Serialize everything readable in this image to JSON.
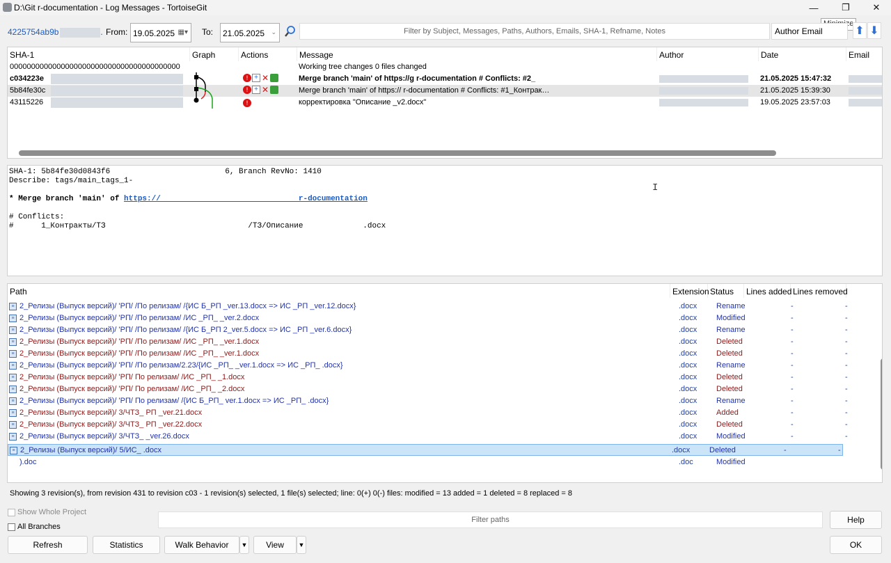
{
  "window": {
    "title": "D:\\Git        r-documentation - Log Messages - TortoiseGit",
    "minimize_glyph": "—",
    "restore_glyph": "❐",
    "close_glyph": "✕",
    "tooltip": "Minimize"
  },
  "toolbar": {
    "sha": "4225754ab9b",
    "from_label": "From:",
    "from_date": "19.05.2025",
    "to_label": "To:",
    "to_date": "21.05.2025",
    "filter_placeholder": "Filter by Subject, Messages, Paths, Authors, Emails, SHA-1, Refname, Notes",
    "author_filter": "Author Email",
    "up_glyph": "⬆",
    "down_glyph": "⬇"
  },
  "log": {
    "columns": [
      "SHA-1",
      "Graph",
      "Actions",
      "Message",
      "Author",
      "Date",
      "Email"
    ],
    "rows": [
      {
        "sha": "0000000000000000000000000000000000000000",
        "message": "Working tree changes  0 files changed",
        "date": ""
      },
      {
        "sha": "c034223e",
        "message": "Merge branch 'main' of https://g                              r-documentation  # Conflicts: #2_",
        "date": "21.05.2025 15:47:32"
      },
      {
        "sha": "5b84fe30c",
        "message": "Merge branch 'main' of https://                              r-documentation  # Conflicts: #1_Контрак…",
        "date": "21.05.2025 15:39:30"
      },
      {
        "sha": "43115226",
        "message": "корректировка \"Описание                                _v2.docx\"",
        "date": "19.05.2025 23:57:03"
      }
    ]
  },
  "detail": {
    "line1": "SHA-1: 5b84fe30d0843f6                         6, Branch RevNo: 1410",
    "line2": "Describe: tags/main_tags_1-",
    "merge_prefix": "* Merge branch 'main' of ",
    "merge_url": "https://                              r-documentation",
    "conflicts": "# Conflicts:",
    "conflict_line": "#      1_Контракты/ТЗ                               /ТЗ/Описание             .docx"
  },
  "files": {
    "columns": [
      "Path",
      "Extension",
      "Status",
      "Lines added",
      "Lines removed"
    ],
    "rows": [
      {
        "path": "2_Релизы (Выпуск версий)/        'РП/         /По релизам/    /{ИС         Б_РП           _ver.13.docx => ИС        _РП              _ver.12.docx}",
        "ext": ".docx",
        "status": "Rename",
        "added": "-",
        "removed": "-"
      },
      {
        "path": "2_Релизы (Выпуск версий)/        'РП/         /По релизам/    /ИС          _РП_           _ver.2.docx",
        "ext": ".docx",
        "status": "Modified",
        "added": "-",
        "removed": "-"
      },
      {
        "path": "2_Релизы (Выпуск версий)/        'РП/         /По релизам/    /{ИС         Б_РП           2_ver.5.docx => ИС        _РП              _ver.6.docx}",
        "ext": ".docx",
        "status": "Rename",
        "added": "-",
        "removed": "-"
      },
      {
        "path": "2_Релизы (Выпуск версий)/        'РП/         /По релизам/    /ИС          _РП_           _ver.1.docx",
        "ext": ".docx",
        "status": "Deleted",
        "added": "-",
        "removed": "-"
      },
      {
        "path": "2_Релизы (Выпуск версий)/        'РП/         /По релизам/    /ИС          _РП_           _ver.1.docx",
        "ext": ".docx",
        "status": "Deleted",
        "added": "-",
        "removed": "-"
      },
      {
        "path": "2_Релизы (Выпуск версий)/        'РП/          /По релизам/2.23/{ИС            _РП_       _ver.1.docx => ИС         _РП_       .docx}",
        "ext": ".docx",
        "status": "Rename",
        "added": "-",
        "removed": "-"
      },
      {
        "path": "2_Релизы (Выпуск версий)/        'РП/     По релизам/    /ИС         _РП_          _1.docx",
        "ext": ".docx",
        "status": "Deleted",
        "added": "-",
        "removed": "-"
      },
      {
        "path": "2_Релизы (Выпуск версий)/        'РП/     По релизам/    /ИС         _РП_          _2.docx",
        "ext": ".docx",
        "status": "Deleted",
        "added": "-",
        "removed": "-"
      },
      {
        "path": "2_Релизы (Выпуск версий)/        'РП/          По релизам/    /{ИС        Б_РП_        ver.1.docx => ИС         _РП_       .docx}",
        "ext": ".docx",
        "status": "Rename",
        "added": "-",
        "removed": "-"
      },
      {
        "path": "2_Релизы (Выпуск версий)/        3/ЧТЗ_      РП                                _ver.21.docx",
        "ext": ".docx",
        "status": "Added",
        "added": "-",
        "removed": "-"
      },
      {
        "path": "2_Релизы (Выпуск версий)/        3/ЧТЗ_      РП                                _ver.22.docx",
        "ext": ".docx",
        "status": "Deleted",
        "added": "-",
        "removed": "-"
      },
      {
        "path": "2_Релизы (Выпуск версий)/        3/ЧТЗ_                       _ver.26.docx",
        "ext": ".docx",
        "status": "Modified",
        "added": "-",
        "removed": "-"
      },
      {
        "path": "2_Релизы (Выпуск версий)/        5/ИС_                        .docx",
        "ext": ".docx",
        "status": "Deleted",
        "added": "-",
        "removed": "-"
      },
      {
        "path": "                                                                                  ).doc",
        "ext": ".doc",
        "status": "Modified",
        "added": "",
        "removed": ""
      }
    ]
  },
  "status_line": "Showing 3 revision(s), from revision 431         to revision c03        - 1 revision(s) selected, 1 file(s) selected; line: 0(+) 0(-) files: modified = 13 added = 1 deleted = 8 replaced = 8",
  "bottom": {
    "show_whole_project": "Show Whole Project",
    "all_branches": "All Branches",
    "filter_paths": "Filter paths",
    "help": "Help",
    "refresh": "Refresh",
    "statistics": "Statistics",
    "walk_behavior": "Walk Behavior",
    "view": "View",
    "ok": "OK"
  },
  "colors": {
    "link": "#1a5bc4",
    "path_maroon": "#8b1a1a",
    "path_blue": "#2233aa",
    "selected_row": "#cce4f7"
  },
  "icons": [
    "app-icon",
    "search-icon",
    "arrow-up-icon",
    "arrow-down-icon",
    "file-icon",
    "conflict-icon",
    "merge-icon",
    "delete-icon",
    "commit-icon"
  ]
}
